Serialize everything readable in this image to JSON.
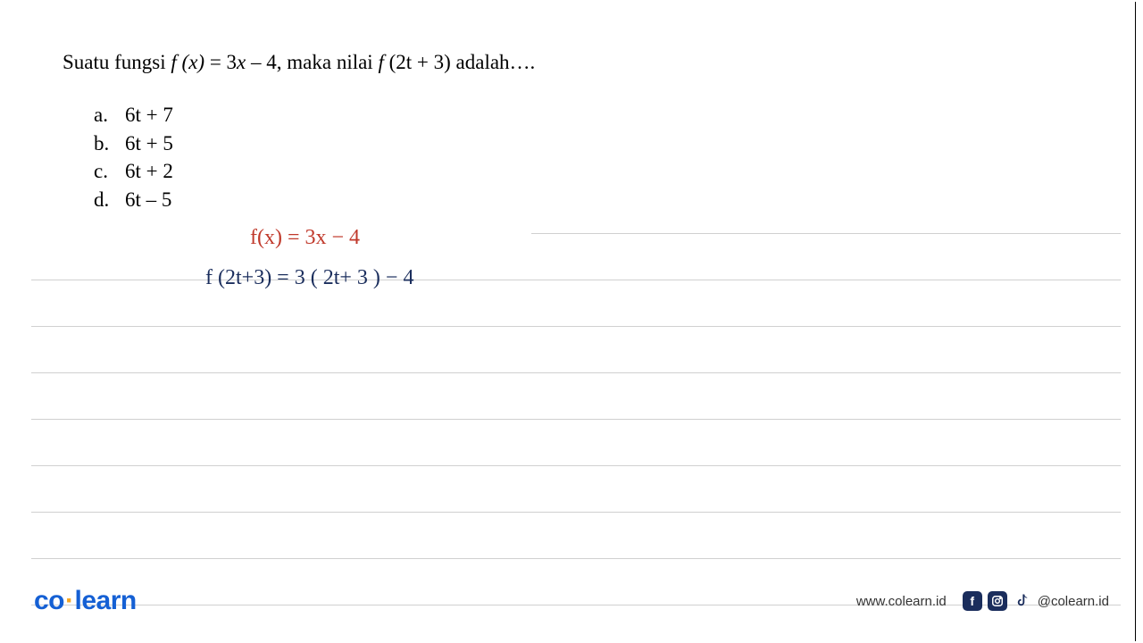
{
  "question": {
    "prefix": "Suatu fungsi ",
    "func": "f (x)",
    "eq": " = 3",
    "var1": "x",
    "mid": " – 4, maka nilai ",
    "func2": "f ",
    "arg2": "(2t + 3)",
    "suffix": " adalah…."
  },
  "options": [
    {
      "letter": "a.",
      "text": "6t + 7"
    },
    {
      "letter": "b.",
      "text": "6t + 5"
    },
    {
      "letter": "c.",
      "text": "6t + 2"
    },
    {
      "letter": "d.",
      "text": "6t – 5"
    }
  ],
  "handwriting": {
    "line1": "f(x) = 3x − 4",
    "line2": "f (2t+3) = 3 ( 2t+ 3 ) − 4"
  },
  "footer": {
    "logo_co": "co",
    "logo_learn": "learn",
    "website": "www.colearn.id",
    "handle": "@colearn.id"
  },
  "icons": {
    "facebook": "f",
    "instagram": "◎",
    "tiktok": "♪"
  }
}
